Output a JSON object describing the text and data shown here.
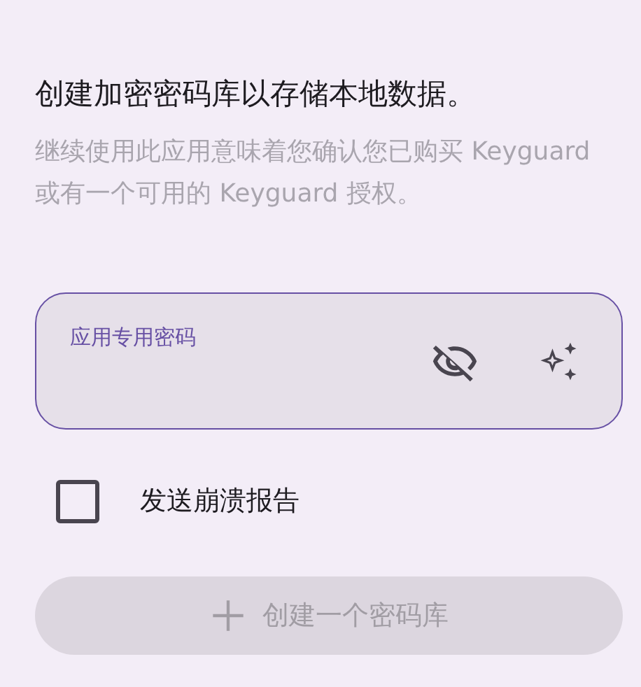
{
  "title": "创建加密密码库以存储本地数据。",
  "subtitle": "继续使用此应用意味着您确认您已购买 Keyguard 或有一个可用的 Keyguard 授权。",
  "password_field": {
    "label": "应用专用密码",
    "password_visible": false
  },
  "crash_report": {
    "label": "发送崩溃报告",
    "checked": false
  },
  "create_button": {
    "label": "创建一个密码库",
    "disabled": true
  }
}
